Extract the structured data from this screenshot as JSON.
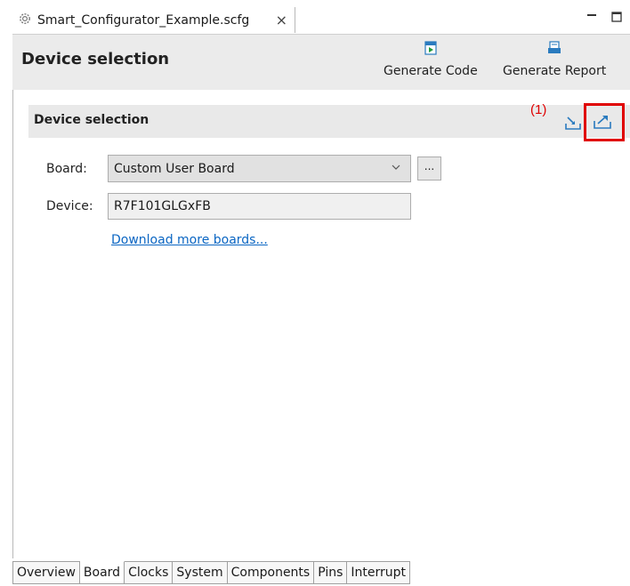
{
  "tab": {
    "icon": "gear-icon",
    "title": "Smart_Configurator_Example.scfg",
    "close": "×"
  },
  "window_controls": {
    "minimize_icon": "minimize-icon",
    "maximize_icon": "maximize-icon"
  },
  "header": {
    "title": "Device selection",
    "generate_code": {
      "label": "Generate Code",
      "icon": "generate-code-icon"
    },
    "generate_report": {
      "label": "Generate Report",
      "icon": "generate-report-icon"
    }
  },
  "section": {
    "title": "Device selection",
    "annotation": "(1)",
    "import_icon": "import-icon",
    "export_icon": "export-icon",
    "highlight_color": "#e00000"
  },
  "form": {
    "board_label": "Board:",
    "board_value": "Custom User Board",
    "browse_label": "...",
    "device_label": "Device:",
    "device_value": "R7F101GLGxFB",
    "download_link": "Download more boards..."
  },
  "bottom_tabs": [
    {
      "label": "Overview",
      "active": false
    },
    {
      "label": "Board",
      "active": true
    },
    {
      "label": "Clocks",
      "active": false
    },
    {
      "label": "System",
      "active": false
    },
    {
      "label": "Components",
      "active": false
    },
    {
      "label": "Pins",
      "active": false
    },
    {
      "label": "Interrupt",
      "active": false
    }
  ]
}
